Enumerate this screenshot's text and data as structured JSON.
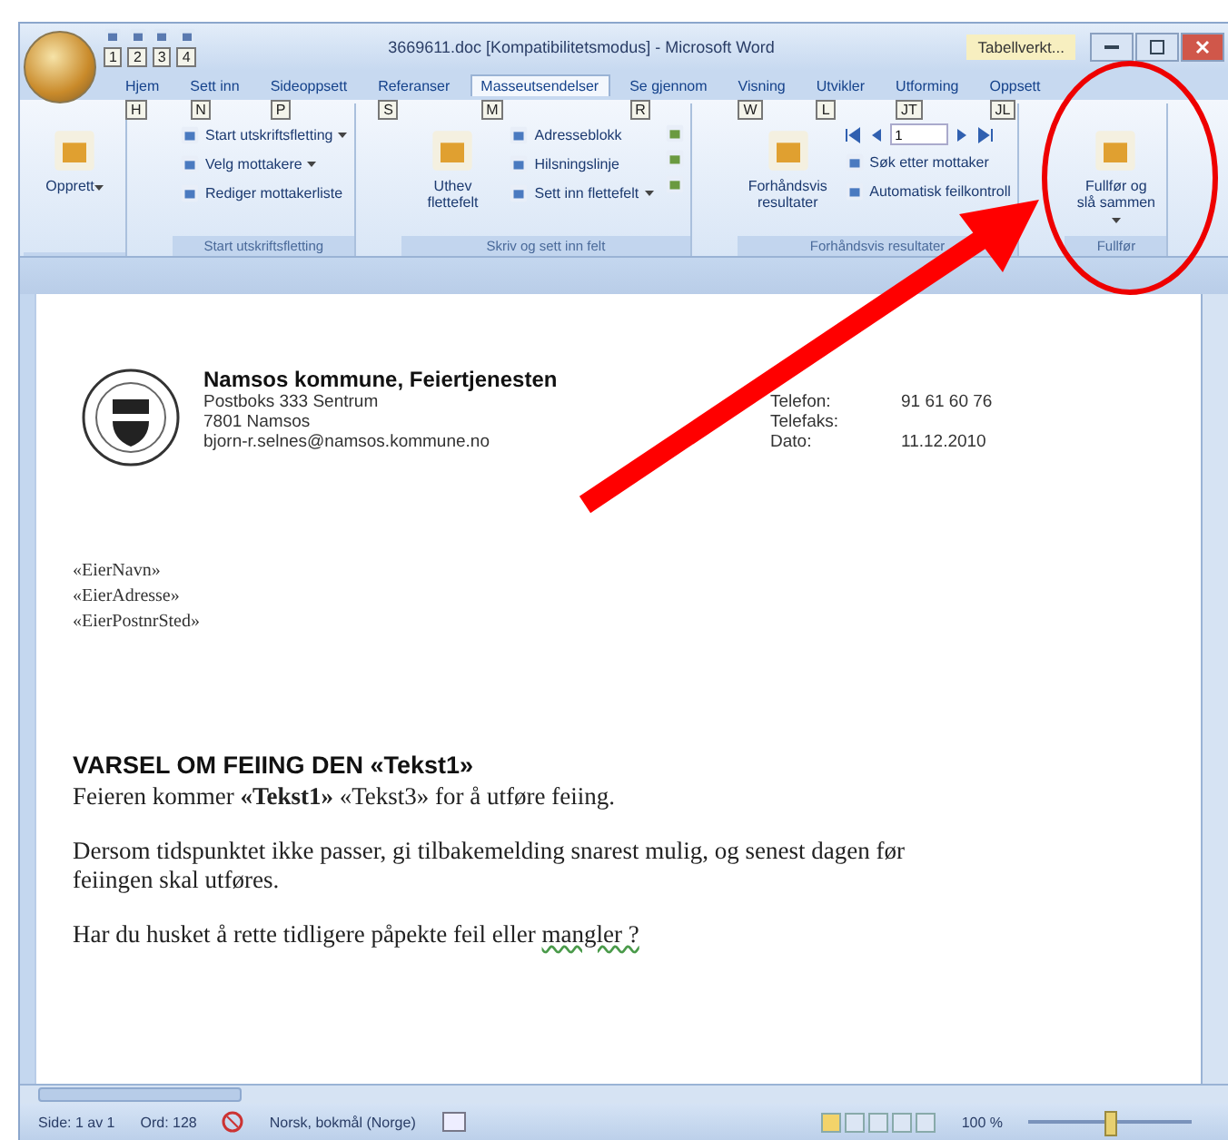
{
  "window": {
    "title": "3669611.doc [Kompatibilitetsmodus] - Microsoft Word",
    "quick_access_keytips": [
      "1",
      "2",
      "3",
      "4"
    ],
    "context_tab": "Tabellverkt..."
  },
  "tabs": [
    {
      "label": "Hjem",
      "keytip": "H",
      "selected": false
    },
    {
      "label": "Sett inn",
      "keytip": "N",
      "selected": false
    },
    {
      "label": "Sideoppsett",
      "keytip": "P",
      "selected": false
    },
    {
      "label": "Referanser",
      "keytip": "S",
      "selected": false
    },
    {
      "label": "Masseutsendelser",
      "keytip": "M",
      "selected": true
    },
    {
      "label": "Se gjennom",
      "keytip": "R",
      "selected": false
    },
    {
      "label": "Visning",
      "keytip": "W",
      "selected": false
    },
    {
      "label": "Utvikler",
      "keytip": "L",
      "selected": false
    },
    {
      "label": "Utforming",
      "keytip": "JT",
      "selected": false
    },
    {
      "label": "Oppsett",
      "keytip": "JL",
      "selected": false
    }
  ],
  "ribbon": {
    "groups": [
      {
        "items": [
          {
            "kind": "large",
            "label": "Opprett",
            "dropdown": true
          }
        ]
      },
      {
        "title": "Start utskriftsfletting",
        "items": [
          {
            "kind": "small",
            "label": "Start utskriftsfletting",
            "dropdown": true
          },
          {
            "kind": "small",
            "label": "Velg mottakere",
            "dropdown": true
          },
          {
            "kind": "small",
            "label": "Rediger mottakerliste",
            "dropdown": false
          }
        ]
      },
      {
        "title": "Skriv og sett inn felt",
        "items": [
          {
            "kind": "large",
            "label": "Uthev flettefelt",
            "dropdown": false
          },
          {
            "kind": "small",
            "label": "Adresseblokk",
            "dropdown": false
          },
          {
            "kind": "small",
            "label": "Hilsningslinje",
            "dropdown": false
          },
          {
            "kind": "small",
            "label": "Sett inn flettefelt",
            "dropdown": true
          },
          {
            "kind": "icons"
          }
        ]
      },
      {
        "title": "Forhåndsvis resultater",
        "items": [
          {
            "kind": "large",
            "label": "Forhåndsvis resultater",
            "dropdown": false
          },
          {
            "kind": "nav",
            "record": "1"
          },
          {
            "kind": "small",
            "label": "Søk etter mottaker",
            "dropdown": false
          },
          {
            "kind": "small",
            "label": "Automatisk feilkontroll",
            "dropdown": false
          }
        ]
      },
      {
        "title": "Fullfør",
        "items": [
          {
            "kind": "large",
            "label": "Fullfør og slå sammen",
            "dropdown": true
          }
        ]
      }
    ]
  },
  "document": {
    "letterhead": {
      "name": "Namsos kommune, Feiertjenesten",
      "address_lines": [
        "Postboks 333 Sentrum",
        "7801 Namsos",
        "bjorn-r.selnes@namsos.kommune.no"
      ],
      "contact": [
        {
          "label": "Telefon:",
          "value": "91 61 60 76"
        },
        {
          "label": "Telefaks:"
        },
        {
          "label": "Dato:",
          "value": "11.12.2010"
        }
      ]
    },
    "fields": [
      "«EierNavn»",
      "«EierAdresse»",
      "«EierPostnrSted»"
    ],
    "heading": "VARSEL OM FEIING DEN «Tekst1»",
    "paragraphs": [
      {
        "text": "Feieren kommer **«Tekst1»** «Tekst3» for å utføre feiing."
      },
      {
        "text": "Dersom tidspunktet ikke passer, gi tilbakemelding snarest mulig, og senest dagen før feiingen skal utføres."
      },
      {
        "text": "Har du husket å rette tidligere påpekte feil eller ",
        "flagged": "mangler ?"
      }
    ]
  },
  "status_bar": {
    "page": "Side: 1 av 1",
    "words": "Ord: 128",
    "language": "Norsk, bokmål (Norge)",
    "zoom": "100 %",
    "zoom_slider": {
      "level": 0.5
    }
  }
}
